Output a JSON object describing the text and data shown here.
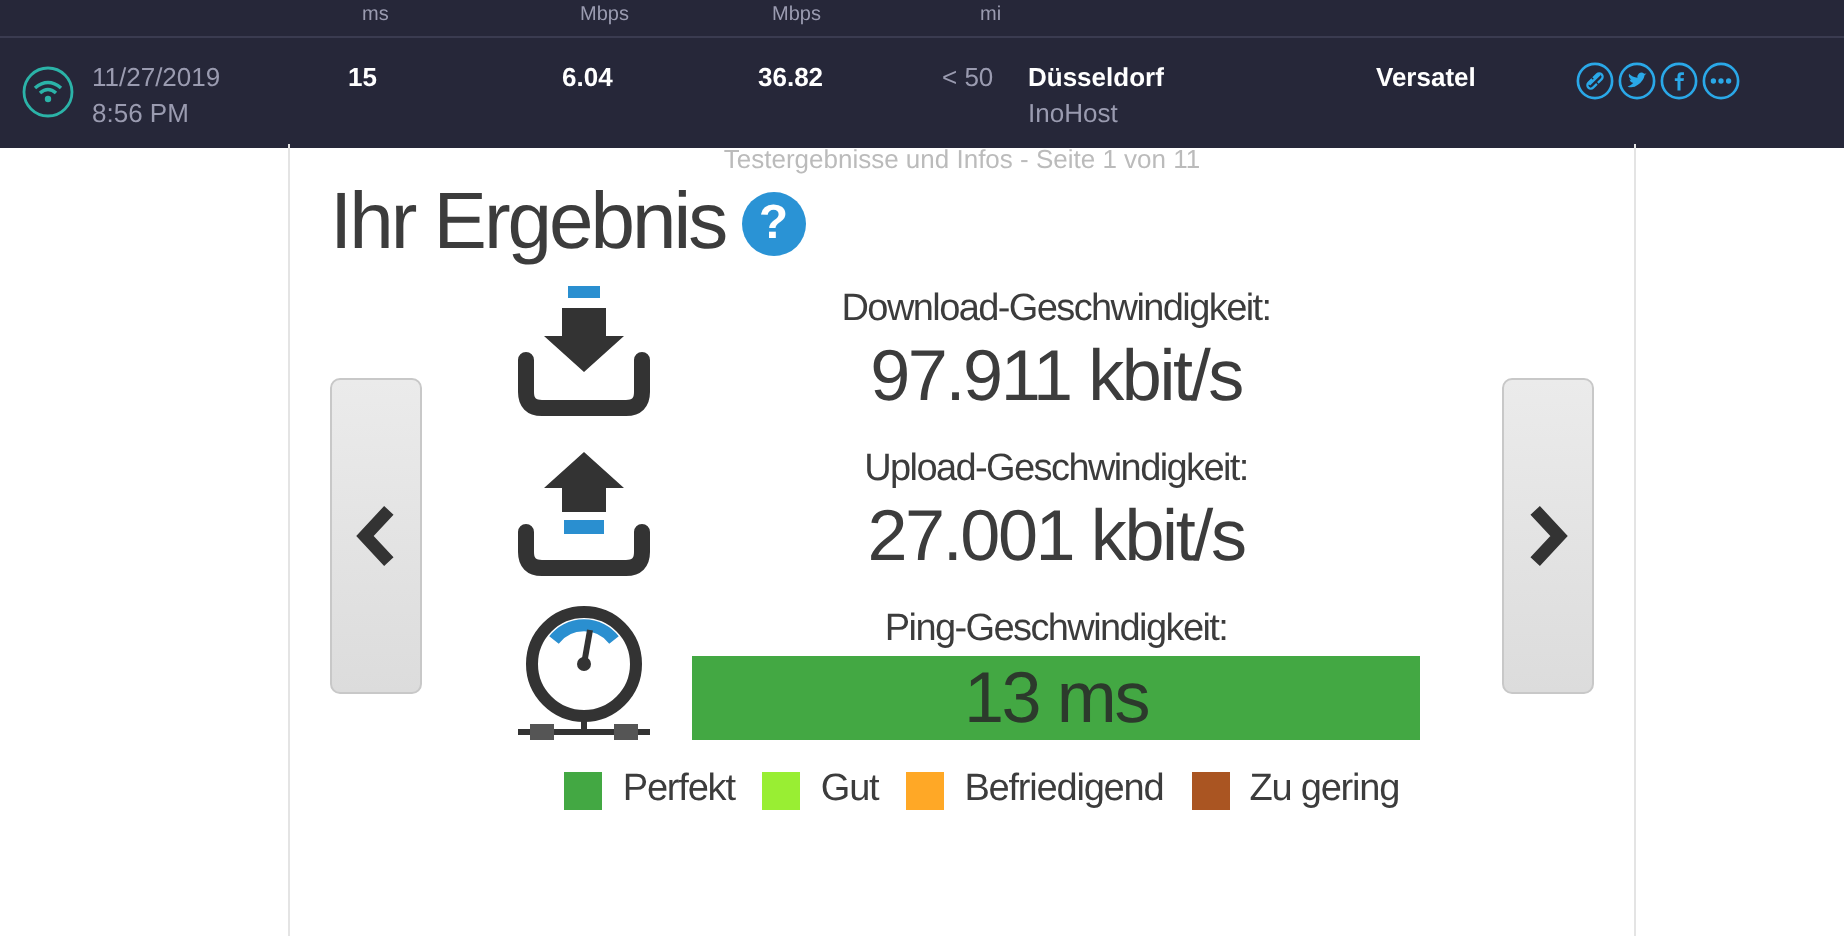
{
  "top_bar": {
    "units": [
      "ms",
      "Mbps",
      "Mbps",
      "mi"
    ],
    "result": {
      "date": "11/27/2019",
      "time": "8:56 PM",
      "ping": "15",
      "download": "6.04",
      "upload": "36.82",
      "distance": "< 50",
      "city": "Düsseldorf",
      "host": "InoHost",
      "provider": "Versatel"
    }
  },
  "subtitle": "Testergebnisse und Infos - Seite 1 von 11",
  "title": "Ihr Ergebnis",
  "help_icon": "?",
  "stats": [
    {
      "kind": "download",
      "label": "Download-Geschwindigkeit:",
      "value": "97.911 kbit/s"
    },
    {
      "kind": "upload",
      "label": "Upload-Geschwindigkeit:",
      "value": "27.001 kbit/s"
    },
    {
      "kind": "ping",
      "label": "Ping-Geschwindigkeit:",
      "value": "13 ms",
      "color": "#43a843"
    }
  ],
  "legend": [
    {
      "label": "Perfekt",
      "color": "#43a843"
    },
    {
      "label": "Gut",
      "color": "#99ee33"
    },
    {
      "label": "Befriedigend",
      "color": "#ffa826"
    },
    {
      "label": "Zu gering",
      "color": "#aa5522"
    }
  ]
}
